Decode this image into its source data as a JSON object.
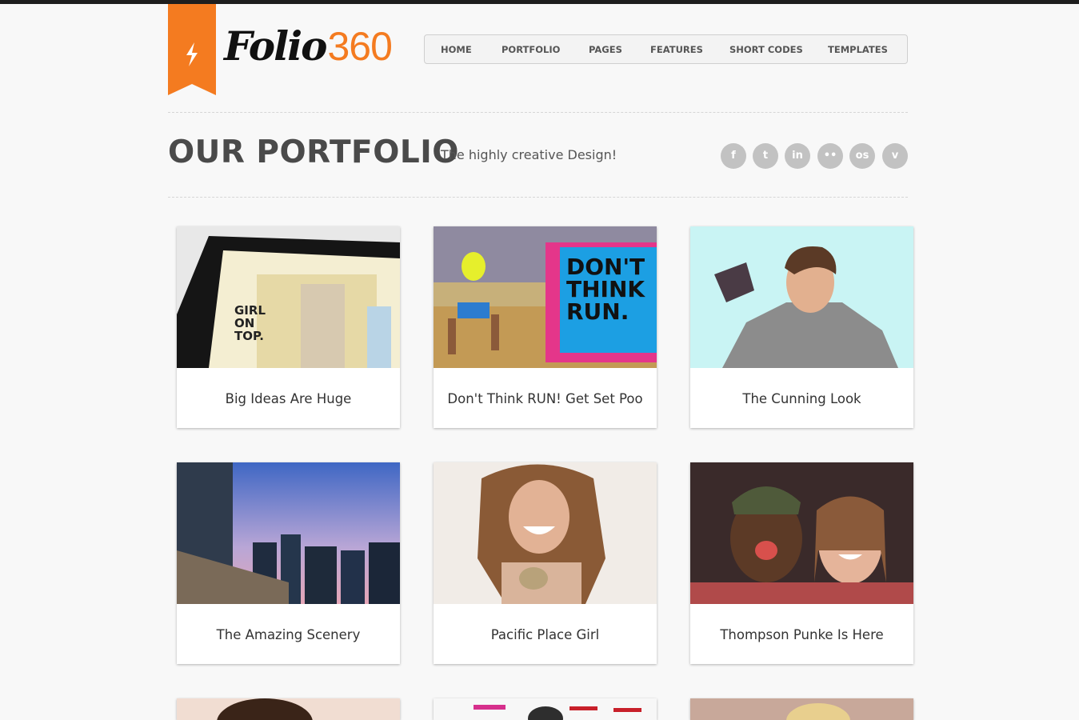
{
  "brand": {
    "name_script": "Folio",
    "name_number": "360",
    "accent": "#f47b20",
    "icon": "lightning-bolt-icon"
  },
  "nav": [
    "HOME",
    "PORTFOLIO",
    "PAGES",
    "FEATURES",
    "SHORT CODES",
    "TEMPLATES"
  ],
  "header": {
    "title": "OUR PORTFOLIO",
    "subtitle": "The highly creative Design!"
  },
  "social": [
    {
      "name": "facebook-icon",
      "glyph": "f"
    },
    {
      "name": "twitter-icon",
      "glyph": "t"
    },
    {
      "name": "linkedin-icon",
      "glyph": "in"
    },
    {
      "name": "flickr-icon",
      "glyph": "••"
    },
    {
      "name": "lastfm-icon",
      "glyph": "os"
    },
    {
      "name": "vimeo-icon",
      "glyph": "v"
    }
  ],
  "portfolio": [
    {
      "title": "Big Ideas Are Huge",
      "image": "tablet-website-thumbnail"
    },
    {
      "title": "Don't Think RUN! Get Set Poo",
      "image": "runner-poster-thumbnail"
    },
    {
      "title": "The Cunning Look",
      "image": "young-man-thumbnail"
    },
    {
      "title": "The Amazing Scenery",
      "image": "city-skyline-thumbnail"
    },
    {
      "title": "Pacific Place Girl",
      "image": "laughing-woman-thumbnail"
    },
    {
      "title": "Thompson Punke Is Here",
      "image": "party-friends-thumbnail"
    }
  ]
}
